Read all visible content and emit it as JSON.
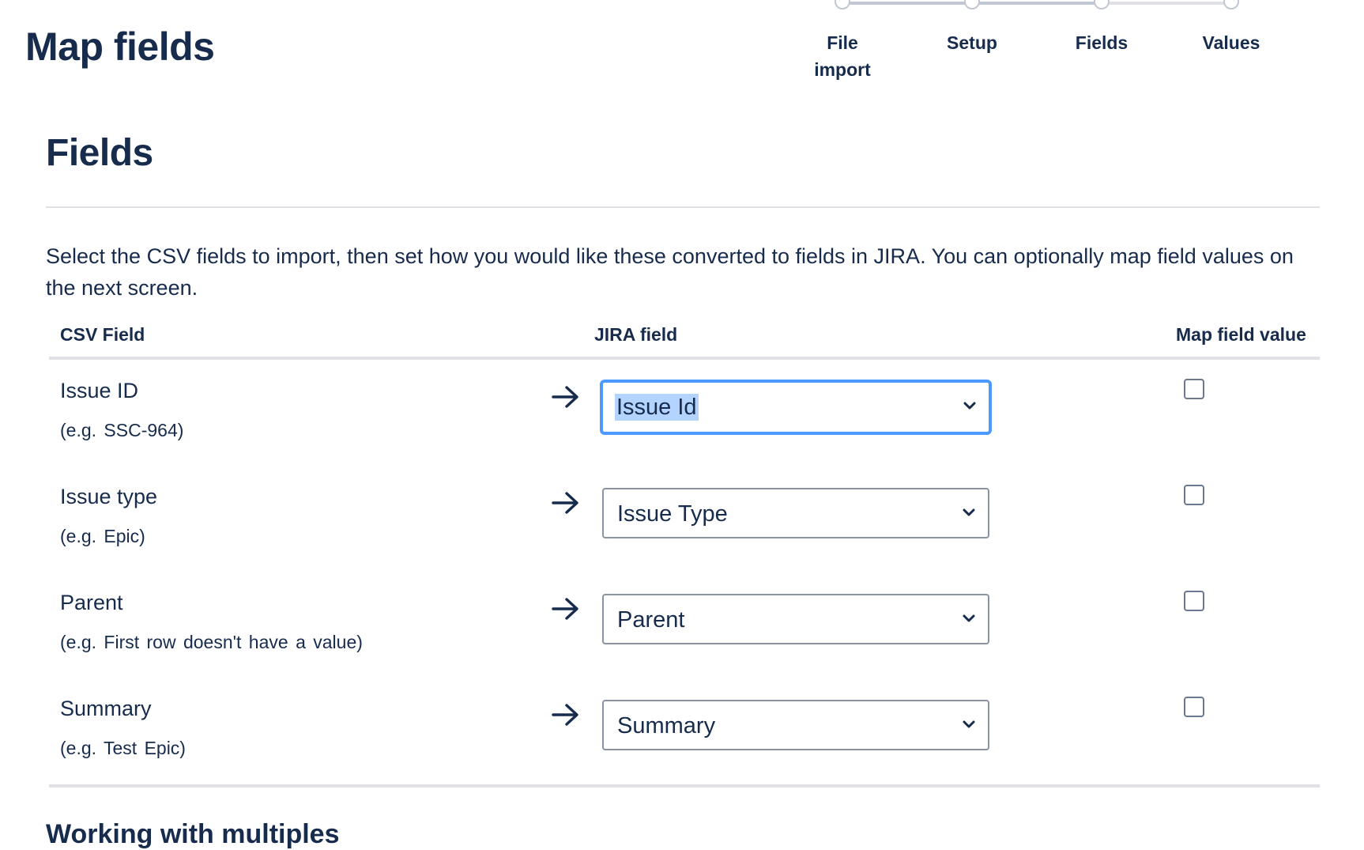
{
  "page": {
    "title": "Map fields"
  },
  "tracker": {
    "steps": [
      {
        "label": "File import",
        "state": "complete"
      },
      {
        "label": "Setup",
        "state": "complete"
      },
      {
        "label": "Fields",
        "state": "current"
      },
      {
        "label": "Values",
        "state": "upcoming"
      }
    ]
  },
  "section": {
    "title": "Fields",
    "description": "Select the CSV fields to import, then set how you would like these converted to fields in JIRA. You can optionally map field values on the next screen."
  },
  "table": {
    "headers": {
      "csv_field": "CSV Field",
      "jira_field": "JIRA field",
      "map_value": "Map field value"
    },
    "rows": [
      {
        "csv_field": "Issue ID",
        "example": "(e.g. SSC-964)",
        "jira_field": "Issue Id",
        "map_value": false,
        "focused": true
      },
      {
        "csv_field": "Issue type",
        "example": "(e.g. Epic)",
        "jira_field": "Issue Type",
        "map_value": false,
        "focused": false
      },
      {
        "csv_field": "Parent",
        "example": "(e.g. First row doesn't have a value)",
        "jira_field": "Parent",
        "map_value": false,
        "focused": false
      },
      {
        "csv_field": "Summary",
        "example": "(e.g. Test Epic)",
        "jira_field": "Summary",
        "map_value": false,
        "focused": false
      }
    ]
  },
  "next_section": {
    "title": "Working with multiples"
  },
  "icons": {
    "row_arrow": "arrow-right-icon",
    "select_chevron": "chevron-down-icon"
  },
  "colors": {
    "text": "#172b4d",
    "focus_ring": "#4c9aff",
    "selection": "#b3d4ff",
    "divider": "#dfe1e6"
  }
}
